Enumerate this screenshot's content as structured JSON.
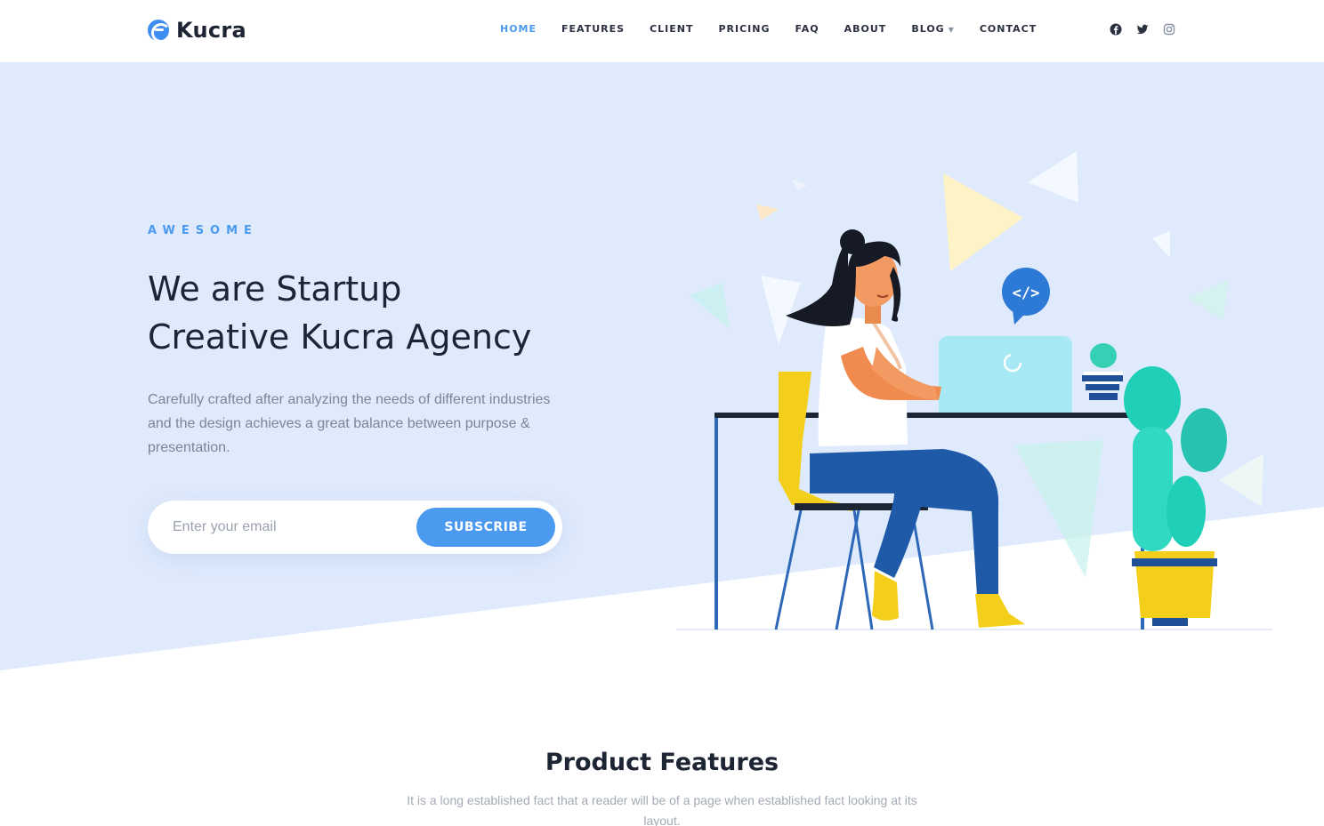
{
  "brand": {
    "name": "Kucra",
    "accent": "#4b9af0",
    "hero_bg": "#dfeafc"
  },
  "nav": {
    "items": [
      {
        "label": "HOME",
        "active": true
      },
      {
        "label": "FEATURES"
      },
      {
        "label": "CLIENT"
      },
      {
        "label": "PRICING"
      },
      {
        "label": "FAQ"
      },
      {
        "label": "ABOUT"
      },
      {
        "label": "BLOG",
        "has_dropdown": true
      },
      {
        "label": "CONTACT"
      }
    ],
    "social": [
      "facebook-icon",
      "twitter-icon",
      "instagram-icon"
    ]
  },
  "hero": {
    "eyebrow": "AWESOME",
    "title_line1": "We are Startup",
    "title_line2": "Creative Kucra Agency",
    "description": "Carefully crafted after analyzing the needs of different industries and the design achieves a great balance between purpose & presentation.",
    "email_placeholder": "Enter your email",
    "subscribe_label": "SUBSCRIBE"
  },
  "features": {
    "title": "Product Features",
    "description": "It is a long established fact that a reader will be of a page when established fact looking at its layout."
  }
}
